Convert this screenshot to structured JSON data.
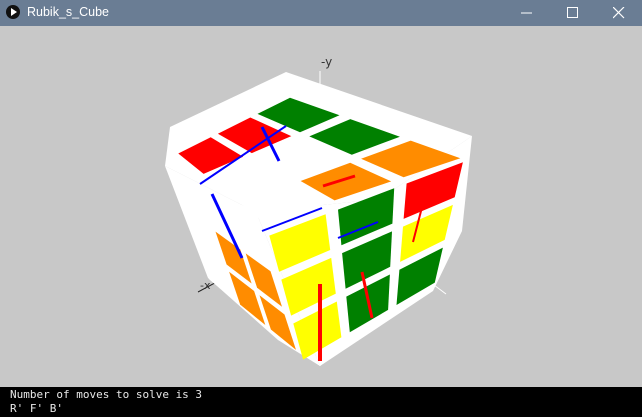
{
  "window": {
    "title": "Rubik_s_Cube"
  },
  "scene": {
    "axis_y_label": "-y",
    "axis_x_label": "-x",
    "colors": {
      "background": "#c8c8c8",
      "white": "#ffffff",
      "red": "#ff0000",
      "green": "#008000",
      "orange": "#ff8c00",
      "yellow": "#ffff00",
      "blue": "#0000ff"
    },
    "top_face": [
      [
        "red",
        "red",
        "green"
      ],
      [
        "white",
        "white",
        "green"
      ],
      [
        "white",
        "orange",
        "orange"
      ]
    ],
    "left_face": [
      [
        "white",
        "white",
        "white"
      ],
      [
        "white",
        "orange",
        "orange"
      ],
      [
        "white",
        "orange",
        "orange"
      ]
    ],
    "right_face": [
      [
        "yellow",
        "green",
        "red"
      ],
      [
        "yellow",
        "green",
        "yellow"
      ],
      [
        "yellow",
        "green",
        "green"
      ]
    ]
  },
  "console": {
    "line1": "Number of moves to solve is 3",
    "line2": "R' F' B'"
  }
}
